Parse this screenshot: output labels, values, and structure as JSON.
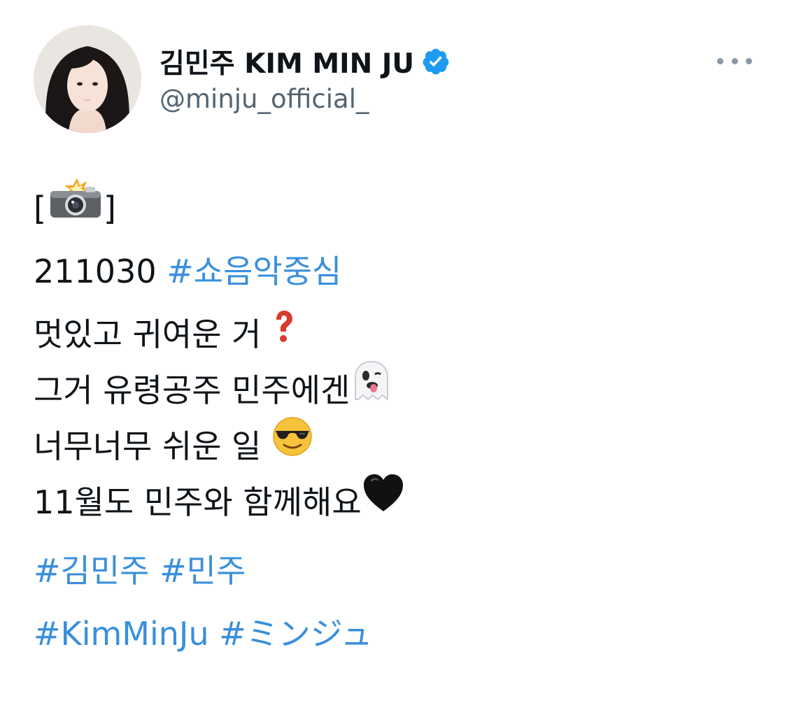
{
  "author": {
    "display_name": "김민주 KIM MIN JU",
    "handle": "@minju_official_",
    "verified": true,
    "avatar": "profile-photo"
  },
  "colors": {
    "hashtag": "#3a8fdc",
    "verified": "#1d9bf0",
    "text": "#0f1419",
    "muted": "#536471"
  },
  "more_icon": "ellipsis-icon",
  "tweet": {
    "line1": {
      "open": "[",
      "emoji": "camera-flash-emoji",
      "close": "]"
    },
    "line2": {
      "date": "211030",
      "hashtag": "#쇼음악중심"
    },
    "lines": [
      {
        "text": "멋있고 귀여운 거",
        "emoji": "red-question-mark-emoji"
      },
      {
        "text": "그거 유령공주 민주에겐",
        "emoji": "ghost-tongue-emoji"
      },
      {
        "text": "너무너무 쉬운 일",
        "emoji": "sunglasses-face-emoji"
      },
      {
        "text": "11월도 민주와 함께해요",
        "emoji": "black-heart-emoji"
      }
    ],
    "hashtags_row1": [
      "#김민주",
      "#민주"
    ],
    "hashtags_row2": [
      "#KimMinJu",
      "#ミンジュ"
    ]
  }
}
